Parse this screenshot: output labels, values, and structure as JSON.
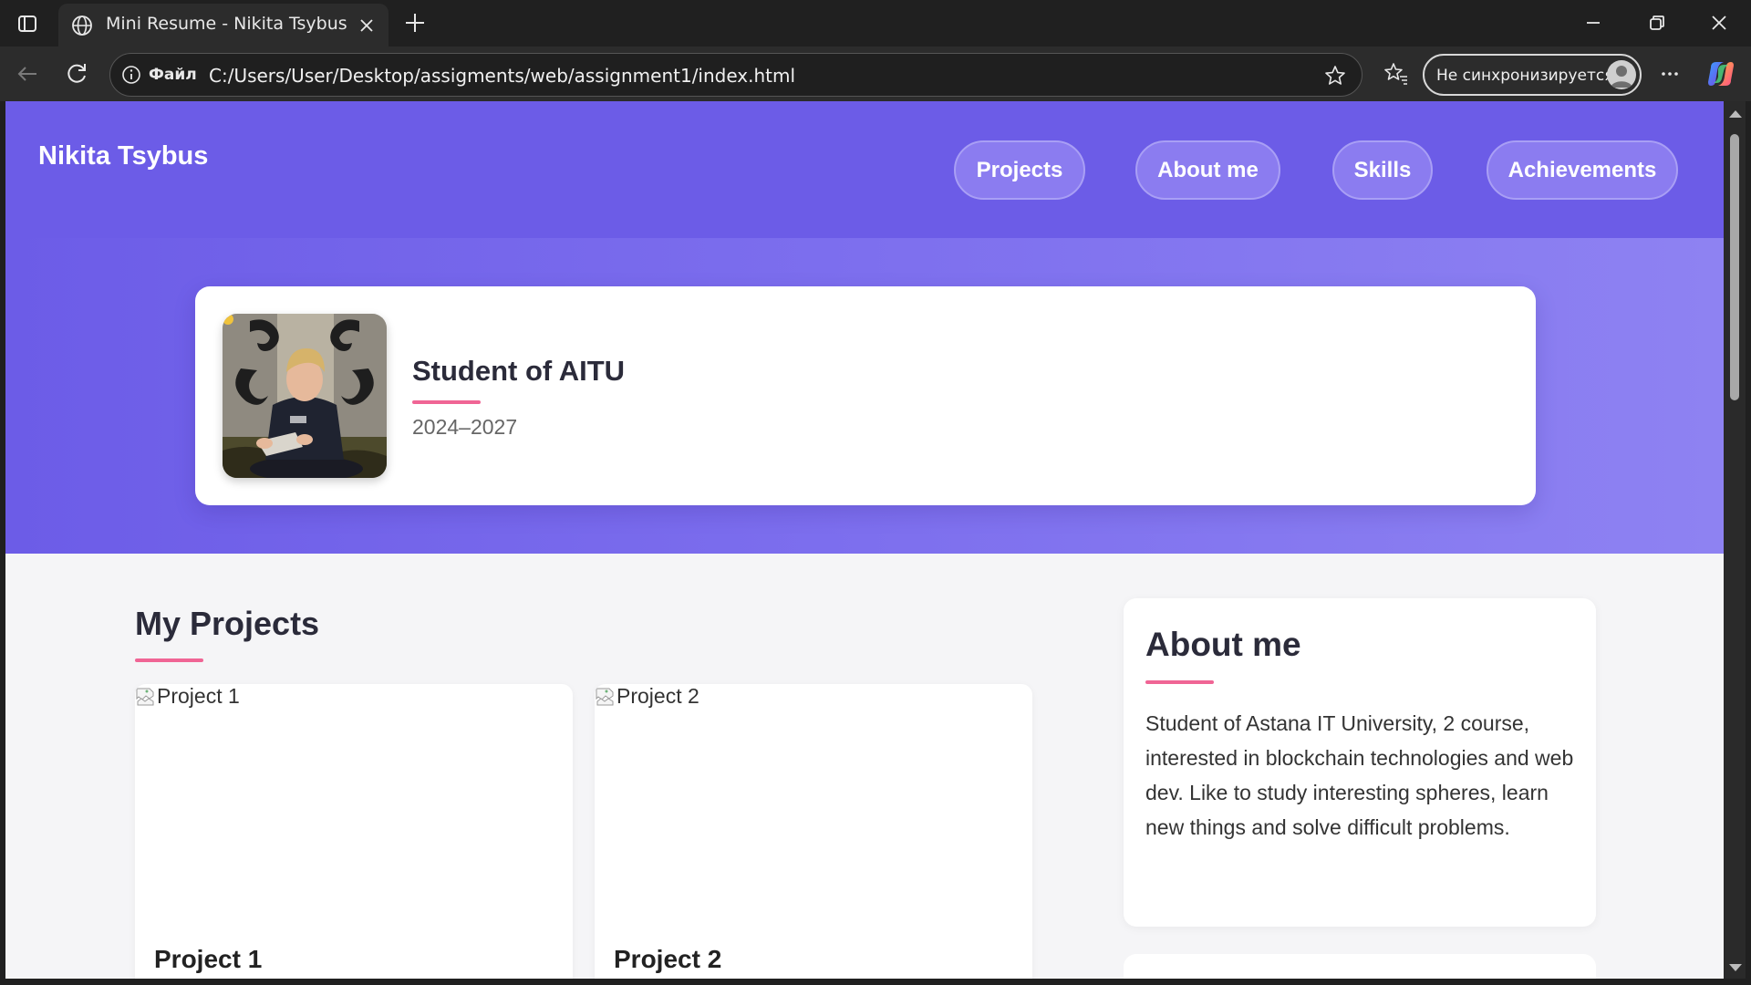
{
  "browser": {
    "tab_title": "Mini Resume - Nikita Tsybus",
    "address_scheme_label": "Файл",
    "address_url": "C:/Users/User/Desktop/assigments/web/assignment1/index.html",
    "sync_label": "Не синхронизируется"
  },
  "header": {
    "brand": "Nikita Tsybus",
    "nav": [
      "Projects",
      "About me",
      "Skills",
      "Achievements"
    ]
  },
  "hero": {
    "title": "Student of AITU",
    "years": "2024–2027"
  },
  "projects": {
    "title": "My Projects",
    "items": [
      {
        "alt": "Project 1",
        "name": "Project 1"
      },
      {
        "alt": "Project 2",
        "name": "Project 2"
      }
    ]
  },
  "about": {
    "title": "About me",
    "text": "Student of Astana IT University, 2 course, interested in blockchain technologies and web dev. Like to study interesting spheres, learn new things and solve difficult problems."
  },
  "colors": {
    "header_bg": "#6c5ce7",
    "accent_rule": "#f06595",
    "nav_button": "#8b7cf0"
  }
}
